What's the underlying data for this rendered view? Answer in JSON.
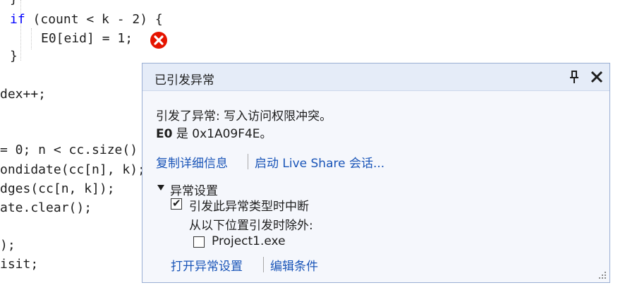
{
  "code": {
    "line_brace_top": "}",
    "if_kw": "if",
    "if_rest": " (count < k - 2) {",
    "assign_line": "E0[eid] = 1;",
    "line_brace_close": "}",
    "line_dex": "dex++;",
    "line_for": "= 0; n < cc.size()",
    "line_cond": "ondidate(cc[n], k);",
    "line_edges": "dges(cc[n, k]);",
    "line_clear": "ate.clear();",
    "line_paren": ");",
    "line_visit": "isit;"
  },
  "popup": {
    "title": "已引发异常",
    "message_line1": "引发了异常: 写入访问权限冲突。",
    "message_var": "E0",
    "message_line2_rest": " 是 0x1A09F4E。",
    "link_copy_details": "复制详细信息",
    "link_live_share": "启动 Live Share 会话...",
    "settings_header": "异常设置",
    "checkbox_break_label": "引发此异常类型时中断",
    "checkbox_break_checked": true,
    "except_when_label": "从以下位置引发时除外:",
    "checkbox_project_label": "Project1.exe",
    "checkbox_project_checked": false,
    "link_open_settings": "打开异常设置",
    "link_edit_conditions": "编辑条件"
  },
  "icons": {
    "error": "error-icon",
    "pin": "pin-icon",
    "close": "close-icon",
    "resize_grip": "resize-grip-icon"
  },
  "colors": {
    "keyword": "#0000ff",
    "link": "#1a55b8",
    "error_red": "#e51400",
    "popup_bg": "#f5f7fc",
    "popup_header": "#e5ecf8"
  }
}
